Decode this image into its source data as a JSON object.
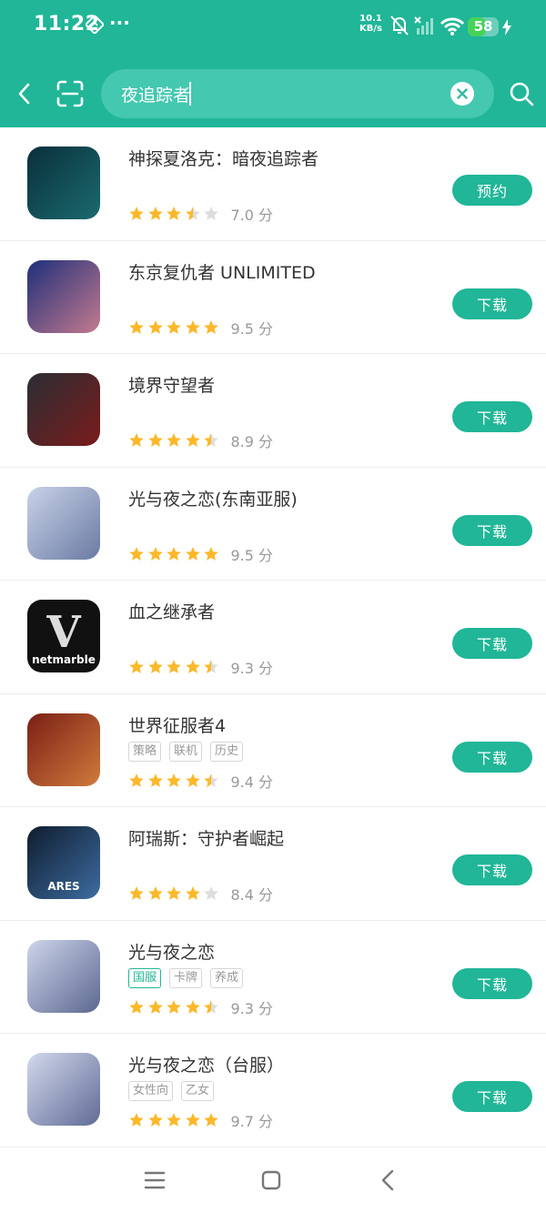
{
  "status_bar": {
    "time": "11:22",
    "network_speed_value": "10.1",
    "network_speed_unit": "KB/s",
    "battery_level": "58",
    "battery_percent": 58
  },
  "header": {
    "search_value": "夜追踪者",
    "back_icon": "chevron-left-icon",
    "scan_icon": "scan-icon",
    "clear_icon": "clear-icon",
    "search_icon": "search-icon"
  },
  "colors": {
    "brand": "#20b697",
    "star": "#fbb829",
    "star_empty": "#dddddd"
  },
  "results": [
    {
      "title": "神探夏洛克：暗夜追踪者",
      "tags": [],
      "stars": 3.5,
      "score": "7.0 分",
      "action": "预约",
      "icon": {
        "bg": "linear-gradient(135deg,#0b2f3a,#1a6a6f)",
        "letter": "",
        "caption": ""
      }
    },
    {
      "title": "东京复仇者 UNLIMITED",
      "tags": [],
      "stars": 5,
      "score": "9.5 分",
      "action": "下载",
      "icon": {
        "bg": "linear-gradient(135deg,#1e2f7a,#c47a8f)",
        "letter": "",
        "caption": ""
      }
    },
    {
      "title": "境界守望者",
      "tags": [],
      "stars": 4.5,
      "score": "8.9 分",
      "action": "下载",
      "icon": {
        "bg": "linear-gradient(135deg,#2a2e35,#7a1b1b)",
        "letter": "",
        "caption": ""
      }
    },
    {
      "title": "光与夜之恋(东南亚服)",
      "tags": [],
      "stars": 5,
      "score": "9.5 分",
      "action": "下载",
      "icon": {
        "bg": "linear-gradient(135deg,#c8d3e8,#6b7aa3)",
        "letter": "",
        "caption": ""
      }
    },
    {
      "title": "血之继承者",
      "tags": [],
      "stars": 4.5,
      "score": "9.3 分",
      "action": "下载",
      "icon": {
        "bg": "#111111",
        "letter": "V",
        "caption": "netmarble"
      }
    },
    {
      "title": "世界征服者4",
      "tags": [
        {
          "label": "策略",
          "hl": false
        },
        {
          "label": "联机",
          "hl": false
        },
        {
          "label": "历史",
          "hl": false
        }
      ],
      "stars": 4.5,
      "score": "9.4 分",
      "action": "下载",
      "icon": {
        "bg": "linear-gradient(135deg,#7a1f16,#d07b3c)",
        "letter": "",
        "caption": ""
      }
    },
    {
      "title": "阿瑞斯：守护者崛起",
      "tags": [],
      "stars": 4,
      "score": "8.4 分",
      "action": "下载",
      "icon": {
        "bg": "linear-gradient(135deg,#0f1d2e,#3d6ca0)",
        "letter": "",
        "caption": "ARES"
      }
    },
    {
      "title": "光与夜之恋",
      "tags": [
        {
          "label": "国服",
          "hl": true
        },
        {
          "label": "卡牌",
          "hl": false
        },
        {
          "label": "养成",
          "hl": false
        }
      ],
      "stars": 4.5,
      "score": "9.3 分",
      "action": "下载",
      "icon": {
        "bg": "linear-gradient(135deg,#cdd5ea,#5c6790)",
        "letter": "",
        "caption": ""
      }
    },
    {
      "title": "光与夜之恋（台服）",
      "tags": [
        {
          "label": "女性向",
          "hl": false
        },
        {
          "label": "乙女",
          "hl": false
        }
      ],
      "stars": 5,
      "score": "9.7 分",
      "action": "下载",
      "icon": {
        "bg": "linear-gradient(135deg,#d2d9ec,#606b96)",
        "letter": "",
        "caption": ""
      }
    }
  ],
  "nav_bar": {
    "menu_icon": "menu-icon",
    "home_icon": "home-icon",
    "back_icon": "back-icon"
  }
}
